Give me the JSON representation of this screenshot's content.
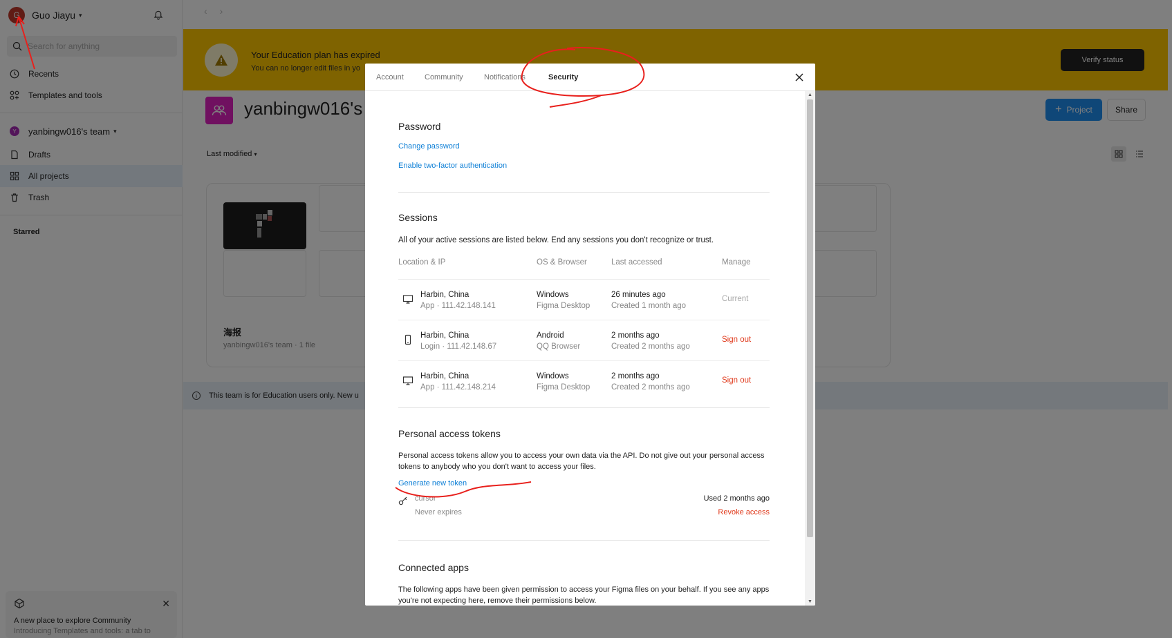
{
  "sidebar": {
    "user": {
      "initial": "G",
      "name": "Guo Jiayu"
    },
    "search_placeholder": "Search for anything",
    "nav": [
      {
        "label": "Recents"
      },
      {
        "label": "Templates and tools"
      }
    ],
    "team": {
      "initial": "Y",
      "name": "yanbingw016's team"
    },
    "team_nav": [
      {
        "label": "Drafts"
      },
      {
        "label": "All projects"
      },
      {
        "label": "Trash"
      }
    ],
    "starred_label": "Starred",
    "promo": {
      "title": "A new place to explore Community",
      "body": "Introducing Templates and tools: a tab to"
    }
  },
  "main": {
    "banner": {
      "title": "Your Education plan has expired",
      "subtitle": "You can no longer edit files in yo",
      "verify_label": "Verify status"
    },
    "project_title": "yanbingw016's",
    "project_button": "Project",
    "share_button": "Share",
    "sort_label": "Last modified",
    "card": {
      "name": "海报",
      "meta": "yanbingw016's team · 1 file"
    },
    "info_text": "This team is for Education users only. New u"
  },
  "modal": {
    "tabs": [
      {
        "label": "Account",
        "active": false
      },
      {
        "label": "Community",
        "active": false
      },
      {
        "label": "Notifications",
        "active": false
      },
      {
        "label": "Security",
        "active": true
      }
    ],
    "password": {
      "title": "Password",
      "change_link": "Change password",
      "twofa_link": "Enable two-factor authentication"
    },
    "sessions": {
      "title": "Sessions",
      "description": "All of your active sessions are listed below. End any sessions you don't recognize or trust.",
      "headers": [
        "Location & IP",
        "OS & Browser",
        "Last accessed",
        "Manage"
      ],
      "rows": [
        {
          "device": "desktop-icon",
          "location": "Harbin, China",
          "ip": "App · 111.42.148.141",
          "os": "Windows",
          "browser": "Figma Desktop",
          "last": "26 minutes ago",
          "created": "Created 1 month ago",
          "manage": "Current"
        },
        {
          "device": "phone-icon",
          "location": "Harbin, China",
          "ip": "Login · 111.42.148.67",
          "os": "Android",
          "browser": "QQ Browser",
          "last": "2 months ago",
          "created": "Created 2 months ago",
          "manage": "Sign out"
        },
        {
          "device": "desktop-icon",
          "location": "Harbin, China",
          "ip": "App · 111.42.148.214",
          "os": "Windows",
          "browser": "Figma Desktop",
          "last": "2 months ago",
          "created": "Created 2 months ago",
          "manage": "Sign out"
        }
      ]
    },
    "tokens": {
      "title": "Personal access tokens",
      "description": "Personal access tokens allow you to access your own data via the API. Do not give out your personal access tokens to anybody who you don't want to access your files.",
      "generate_link": "Generate new token",
      "token": {
        "name": "cursor",
        "expires": "Never expires",
        "used": "Used 2 months ago",
        "revoke": "Revoke access"
      }
    },
    "connected": {
      "title": "Connected apps",
      "description": "The following apps have been given permission to access your Figma files on your behalf. If you see any apps you're not expecting here, remove their permissions below."
    }
  },
  "colors": {
    "accent": "#0d7fd6",
    "banner": "#ffc700",
    "danger": "#e0391b",
    "annotation": "#e8201c"
  }
}
